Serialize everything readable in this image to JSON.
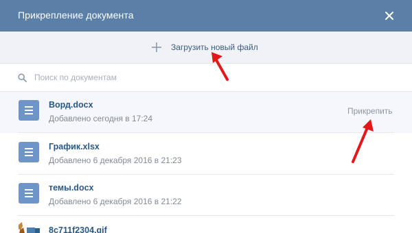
{
  "dialog": {
    "title": "Прикрепление документа",
    "close_icon": "close-icon"
  },
  "upload": {
    "label": "Загрузить новый файл",
    "icon": "plus-icon"
  },
  "search": {
    "placeholder": "Поиск по документам",
    "value": "",
    "icon": "search-icon"
  },
  "documents": [
    {
      "name": "Ворд.docx",
      "added": "Добавлено сегодня в 17:24",
      "action": "Прикрепить",
      "icon": "document-icon"
    },
    {
      "name": "График.xlsx",
      "added": "Добавлено 6 декабря 2016 в 21:23",
      "icon": "document-icon"
    },
    {
      "name": "темы.docx",
      "added": "Добавлено 6 декабря 2016 в 21:22",
      "icon": "document-icon"
    },
    {
      "name": "8c711f2304.gif",
      "added": "",
      "icon": "gif-thumbnail-icon"
    }
  ],
  "colors": {
    "header": "#5b7fa6",
    "link": "#2a5885",
    "doc_icon": "#6e95c8",
    "annotation_arrow": "#e3181b"
  }
}
